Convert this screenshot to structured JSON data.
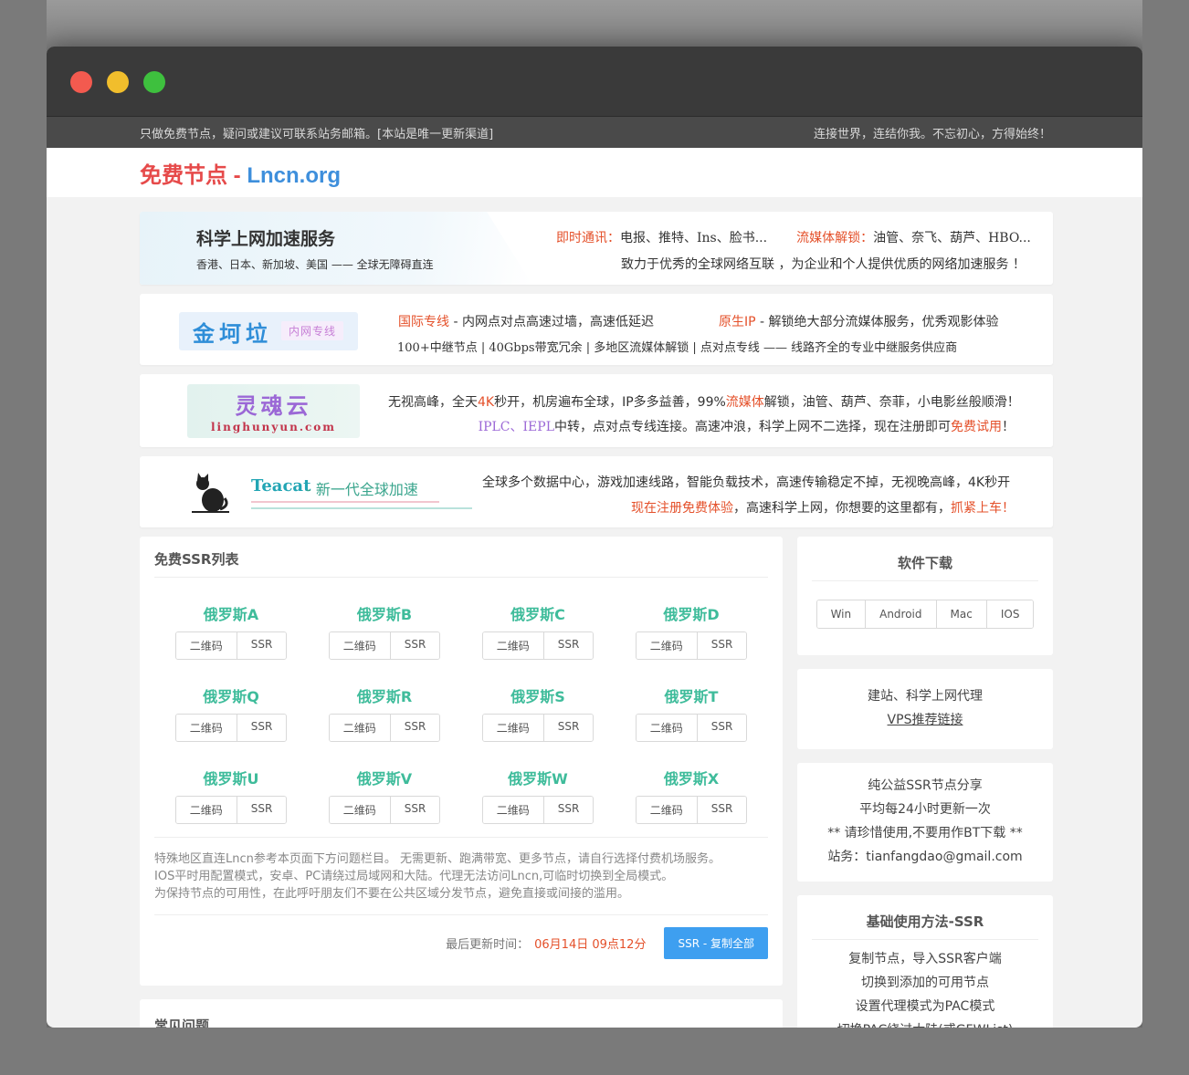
{
  "topbar": {
    "left": "只做免费节点，疑问或建议可联系站务邮箱。[本站是唯一更新渠道]",
    "right": "连接世界，连结你我。不忘初心，方得始终！"
  },
  "logo": {
    "part1": "免费节点",
    "sep": " - ",
    "part2": "Lncn.org"
  },
  "ad1": {
    "title": "科学上网加速服务",
    "subtitle": "香港、日本、新加坡、美国 —— 全球无障碍直连",
    "im_label": "即时通讯：",
    "im_text": "电报、推特、Ins、脸书...",
    "media_label": "流媒体解锁：",
    "media_text": "油管、奈飞、葫芦、HBO...",
    "slogan": "致力于优秀的全球网络互联 ，为企业和个人提供优质的网络加速服务 ！"
  },
  "ad2": {
    "logo_text": "金坷垃",
    "logo_tag": "内网专线",
    "l1_label": "国际专线",
    "l1_text": " - 内网点对点高速过墙，高速低延迟",
    "l2_label": "原生IP",
    "l2_text": " - 解锁绝大部分流媒体服务，优秀观影体验",
    "line2": "100+中继节点 | 40Gbps带宽冗余 | 多地区流媒体解锁 | 点对点专线   —— 线路齐全的专业中继服务供应商"
  },
  "ad3": {
    "logo_text": "灵魂云",
    "logo_url": "linghunyun.com",
    "l1a": "无视高峰，全天",
    "l1b": "4K",
    "l1c": "秒开，机房遍布全球，IP多多益善，99%",
    "l1d": "流媒体",
    "l1e": "解锁，油管、葫芦、奈菲，小电影丝般顺滑！",
    "l2a": "IPLC、IEPL",
    "l2b": "中转，点对点专线连接。高速冲浪，科学上网不二选择，现在注册即可",
    "l2c": "免费试用",
    "l2d": "！"
  },
  "ad4": {
    "name": "Teacat",
    "tagline": " - 新一代全球加速",
    "line1": "全球多个数据中心，游戏加速线路，智能负载技术，高速传输稳定不掉，无视晚高峰，4K秒开",
    "l2a": "现在注册免费体验",
    "l2b": "，高速科学上网，你想要的这里都有，",
    "l2c": "抓紧上车！"
  },
  "ssr": {
    "title": "免费SSR列表",
    "qr_label": "二维码",
    "ssr_label": "SSR",
    "nodes": [
      "俄罗斯A",
      "俄罗斯B",
      "俄罗斯C",
      "俄罗斯D",
      "俄罗斯Q",
      "俄罗斯R",
      "俄罗斯S",
      "俄罗斯T",
      "俄罗斯U",
      "俄罗斯V",
      "俄罗斯W",
      "俄罗斯X"
    ],
    "note1": "特殊地区直连Lncn参考本页面下方问题栏目。 无需更新、跑满带宽、更多节点，请自行选择付费机场服务。",
    "note2": "IOS平时用配置模式，安卓、PC请绕过局域网和大陆。代理无法访问Lncn,可临时切换到全局模式。",
    "note3": "为保持节点的可用性，在此呼吁朋友们不要在公共区域分发节点，避免直接或间接的滥用。",
    "update_label": "最后更新时间：",
    "update_time": "06月14日 09点12分",
    "copy_button": "SSR - 复制全部"
  },
  "faq": {
    "title": "常见问题"
  },
  "download": {
    "title": "软件下载",
    "buttons": [
      "Win",
      "Android",
      "Mac",
      "IOS"
    ]
  },
  "vps": {
    "line1": "建站、科学上网代理",
    "link": "VPS推荐链接"
  },
  "info": {
    "line1": "纯公益SSR节点分享",
    "line2": "平均每24小时更新一次",
    "line3": "** 请珍惜使用,不要用作BT下载 **",
    "line4": "站务：tianfangdao@gmail.com"
  },
  "usage": {
    "title": "基础使用方法-SSR",
    "steps": [
      "复制节点，导入SSR客户端",
      "切换到添加的可用节点",
      "设置代理模式为PAC模式",
      "切换PAC绕过大陆(或GFWList)"
    ]
  }
}
